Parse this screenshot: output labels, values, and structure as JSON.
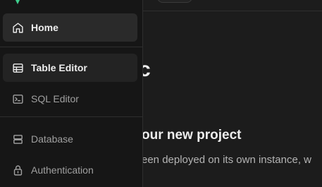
{
  "sidebar": {
    "items": [
      {
        "label": "Home",
        "icon": "home-icon"
      },
      {
        "label": "Table Editor",
        "icon": "table-icon"
      },
      {
        "label": "SQL Editor",
        "icon": "terminal-icon"
      },
      {
        "label": "Database",
        "icon": "database-icon"
      },
      {
        "label": "Authentication",
        "icon": "lock-icon"
      }
    ]
  },
  "main": {
    "heading": "c",
    "subheading": "our new project",
    "description": "een deployed on its own instance, w"
  },
  "colors": {
    "brand_green": "#3ecf8e",
    "sidebar_bg": "#161616",
    "main_bg": "#1c1c1c",
    "active_item_bg": "#2a2a2a"
  }
}
